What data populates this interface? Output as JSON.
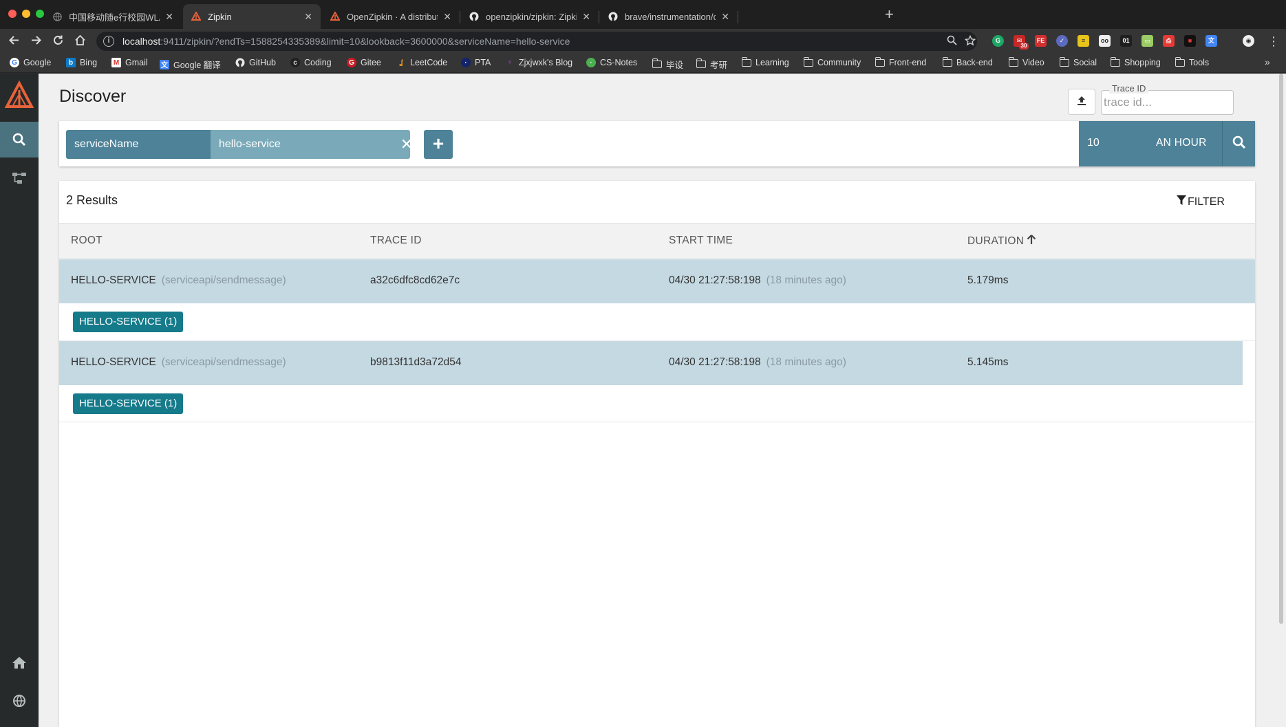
{
  "browser": {
    "tabs": [
      {
        "title": "中国移动随e行校园WLAN业务",
        "icon": "globe-icon"
      },
      {
        "title": "Zipkin",
        "icon": "zipkin-icon",
        "active": true
      },
      {
        "title": "OpenZipkin · A distributed trac",
        "icon": "zipkin-icon"
      },
      {
        "title": "openzipkin/zipkin: Zipkin is a d",
        "icon": "github-icon"
      },
      {
        "title": "brave/instrumentation/dubbo-r",
        "icon": "github-icon"
      }
    ],
    "url_host": "localhost",
    "url_rest": ":9411/zipkin/?endTs=1588254335389&limit=10&lookback=3600000&serviceName=hello-service",
    "extension_badge": "30",
    "bookmarks": [
      {
        "label": "Google",
        "icon": "google-icon"
      },
      {
        "label": "Bing",
        "icon": "bing-icon"
      },
      {
        "label": "Gmail",
        "icon": "gmail-icon"
      },
      {
        "label": "Google 翻译",
        "icon": "translate-icon"
      },
      {
        "label": "GitHub",
        "icon": "github-icon"
      },
      {
        "label": "Coding",
        "icon": "coding-icon"
      },
      {
        "label": "Gitee",
        "icon": "gitee-icon"
      },
      {
        "label": "LeetCode",
        "icon": "leetcode-icon"
      },
      {
        "label": "PTA",
        "icon": "pta-icon"
      },
      {
        "label": "Zjxjwxk's Blog",
        "icon": "blog-icon"
      },
      {
        "label": "CS-Notes",
        "icon": "notes-icon"
      },
      {
        "label": "毕设",
        "icon": "folder-icon"
      },
      {
        "label": "考研",
        "icon": "folder-icon"
      },
      {
        "label": "Learning",
        "icon": "folder-icon"
      },
      {
        "label": "Community",
        "icon": "folder-icon"
      },
      {
        "label": "Front-end",
        "icon": "folder-icon"
      },
      {
        "label": "Back-end",
        "icon": "folder-icon"
      },
      {
        "label": "Video",
        "icon": "folder-icon"
      },
      {
        "label": "Social",
        "icon": "folder-icon"
      },
      {
        "label": "Shopping",
        "icon": "folder-icon"
      },
      {
        "label": "Tools",
        "icon": "folder-icon"
      }
    ],
    "bookmarks_more": "»"
  },
  "app": {
    "title": "Discover",
    "trace_id_label": "Trace ID",
    "trace_id_placeholder": "trace id...",
    "criteria": {
      "key": "serviceName",
      "value": "hello-service"
    },
    "limit": "10",
    "lookback": "AN HOUR",
    "results_count": "2 Results",
    "filter_label": "FILTER",
    "columns": [
      "ROOT",
      "TRACE ID",
      "START TIME",
      "DURATION"
    ],
    "sort_column": "DURATION",
    "traces": [
      {
        "root_service": "HELLO-SERVICE",
        "root_span": "(serviceapi/sendmessage)",
        "trace_id": "a32c6dfc8cd62e7c",
        "start_time": "04/30 21:27:58:198",
        "start_relative": "(18 minutes ago)",
        "duration": "5.179ms",
        "service_badge": "HELLO-SERVICE (1)"
      },
      {
        "root_service": "HELLO-SERVICE",
        "root_span": "(serviceapi/sendmessage)",
        "trace_id": "b9813f11d3a72d54",
        "start_time": "04/30 21:27:58:198",
        "start_relative": "(18 minutes ago)",
        "duration": "5.145ms",
        "service_badge": "HELLO-SERVICE (1)"
      }
    ]
  },
  "colors": {
    "sidebar": "#262a2b",
    "sidebar_active": "#4b727f",
    "criteria_key": "#4e8298",
    "criteria_value": "#7aaab9",
    "trace_row": "#c5d9e2",
    "service_badge": "#157a8a",
    "zipkin_orange": "#e8623a"
  }
}
